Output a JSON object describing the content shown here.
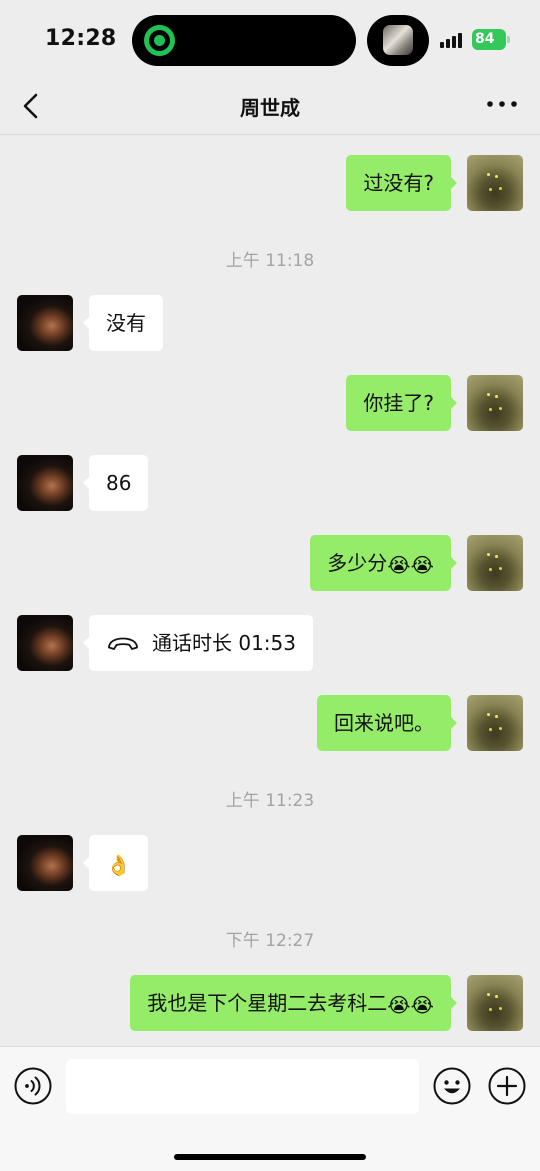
{
  "status_bar": {
    "time": "12:28",
    "battery": "84",
    "icons": [
      "screen-recording-icon",
      "signal-icon",
      "battery-charging-icon"
    ]
  },
  "nav": {
    "title": "周世成",
    "back_icon": "chevron-left-icon",
    "more_icon": "more-icon"
  },
  "messages": [
    {
      "type": "text",
      "sender": "me",
      "text": "过没有?"
    },
    {
      "type": "time",
      "text": "上午 11:18"
    },
    {
      "type": "text",
      "sender": "them",
      "text": "没有"
    },
    {
      "type": "text",
      "sender": "me",
      "text": "你挂了?"
    },
    {
      "type": "text",
      "sender": "them",
      "text": "86"
    },
    {
      "type": "text",
      "sender": "me",
      "text": "多少分",
      "emoji": "😭😭"
    },
    {
      "type": "call",
      "sender": "them",
      "text": "通话时长 01:53",
      "icon": "phone-hangup-icon"
    },
    {
      "type": "text",
      "sender": "me",
      "text": "回来说吧。"
    },
    {
      "type": "time",
      "text": "上午 11:23"
    },
    {
      "type": "emoji",
      "sender": "them",
      "emoji": "👌"
    },
    {
      "type": "time",
      "text": "下午 12:27"
    },
    {
      "type": "text",
      "sender": "me",
      "text": "我也是下个星期二去考科二",
      "emoji": "😭😭"
    }
  ],
  "input_bar": {
    "icons": [
      "voice-icon",
      "emoji-icon",
      "plus-icon"
    ]
  },
  "colors": {
    "background": "#ededed",
    "outgoing_bubble": "#95ec69",
    "incoming_bubble": "#ffffff",
    "timestamp": "#a3a3a3",
    "battery": "#34c759",
    "recording": "#21c15a"
  }
}
